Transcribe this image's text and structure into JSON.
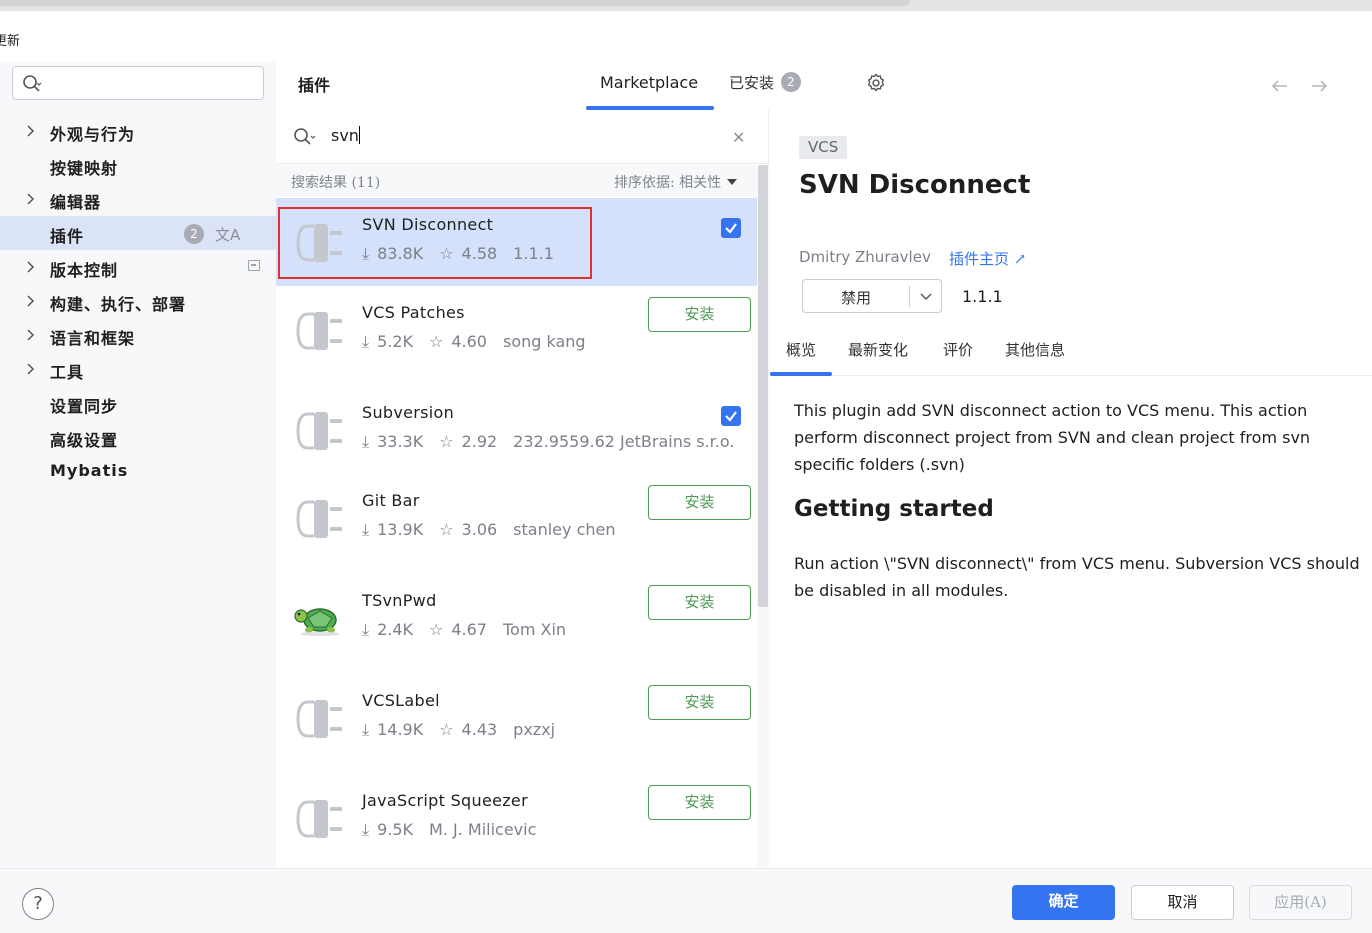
{
  "window": {
    "title": "更新"
  },
  "sidebar": {
    "search_placeholder": "",
    "items": [
      {
        "label": "外观与行为",
        "expandable": true
      },
      {
        "label": "按键映射",
        "expandable": false
      },
      {
        "label": "编辑器",
        "expandable": true
      },
      {
        "label": "插件",
        "expandable": false,
        "selected": true,
        "badge": "2"
      },
      {
        "label": "版本控制",
        "expandable": true
      },
      {
        "label": "构建、执行、部署",
        "expandable": true
      },
      {
        "label": "语言和框架",
        "expandable": true
      },
      {
        "label": "工具",
        "expandable": true
      },
      {
        "label": "设置同步",
        "expandable": false
      },
      {
        "label": "高级设置",
        "expandable": false
      },
      {
        "label": "Mybatis",
        "expandable": false
      }
    ]
  },
  "header": {
    "title": "插件",
    "tab_marketplace": "Marketplace",
    "tab_installed": "已安装",
    "installed_badge": "2"
  },
  "search": {
    "value": "svn"
  },
  "results": {
    "count_label": "搜索结果 (11)",
    "sort_label": "排序依据: 相关性",
    "install_label": "安装",
    "items": [
      {
        "name": "SVN Disconnect",
        "downloads": "83.8K",
        "rating": "4.58",
        "extra": "1.1.1",
        "installed": true,
        "selected": true,
        "icon": "plug-icon"
      },
      {
        "name": "VCS Patches",
        "downloads": "5.2K",
        "rating": "4.60",
        "extra": "song kang",
        "installed": false,
        "icon": "plug-icon"
      },
      {
        "name": "Subversion",
        "downloads": "33.3K",
        "rating": "2.92",
        "extra": "232.9559.62  JetBrains s.r.o.",
        "installed": true,
        "icon": "plug-icon"
      },
      {
        "name": "Git Bar",
        "downloads": "13.9K",
        "rating": "3.06",
        "extra": "stanley chen",
        "installed": false,
        "icon": "plug-icon"
      },
      {
        "name": "TSvnPwd",
        "downloads": "2.4K",
        "rating": "4.67",
        "extra": "Tom Xin",
        "installed": false,
        "icon": "turtle-icon"
      },
      {
        "name": "VCSLabel",
        "downloads": "14.9K",
        "rating": "4.43",
        "extra": "pxzxj",
        "installed": false,
        "icon": "plug-icon"
      },
      {
        "name": "JavaScript Squeezer",
        "downloads": "9.5K",
        "rating": "",
        "extra": "M. J. Milicevic",
        "installed": false,
        "icon": "plug-icon"
      }
    ]
  },
  "detail": {
    "tag": "VCS",
    "title": "SVN Disconnect",
    "author": "Dmitry Zhuravlev",
    "homepage_label": "插件主页 ↗",
    "disable_label": "禁用",
    "version": "1.1.1",
    "tabs": [
      "概览",
      "最新变化",
      "评价",
      "其他信息"
    ],
    "description": "This plugin add SVN disconnect action to VCS menu. This action perform disconnect project from SVN and clean project from svn specific folders (.svn)",
    "heading": "Getting started",
    "instructions": "Run action \\\"SVN disconnect\\\" from VCS menu. Subversion VCS should be disabled in all modules."
  },
  "footer": {
    "help_label": "?",
    "ok_label": "确定",
    "cancel_label": "取消",
    "apply_label": "应用(A)"
  },
  "colors": {
    "accent": "#3574f0",
    "install_green": "#4f9a55",
    "highlight_red": "#e03030",
    "selection": "#d5e1fb"
  }
}
